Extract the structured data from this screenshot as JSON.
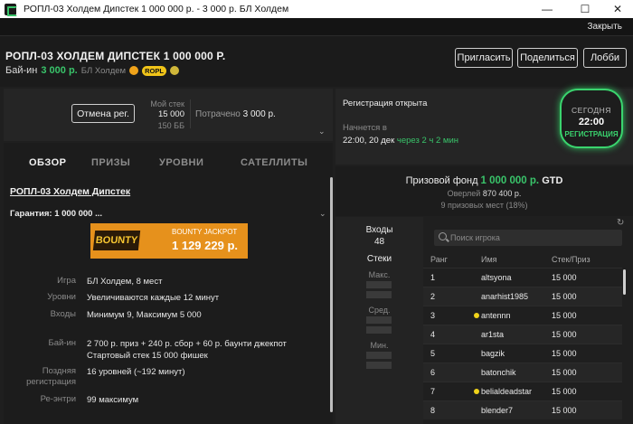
{
  "window": {
    "title": "РОПЛ-03 Холдем Дипстек 1 000 000 р. - 3 000 р. БЛ Холдем",
    "minimize": "—",
    "maximize": "☐",
    "close": "✕"
  },
  "menubar": {
    "close_label": "Закрыть"
  },
  "header": {
    "title": "РОПЛ-03 ХОЛДЕМ ДИПСТЕК 1 000 000 Р.",
    "buyin_label": "Бай-ин",
    "buyin_value": "3 000 р.",
    "game": "БЛ Холдем",
    "ropl_badge": "ROPL",
    "buttons": {
      "invite": "Пригласить",
      "share": "Поделиться",
      "lobby": "Лобби"
    }
  },
  "status": {
    "cancel_label": "Отмена рег.",
    "mystack_label": "Мой стек",
    "mystack_value": "15 000",
    "mystack_bb": "150 ББ",
    "spent_label": "Потрачено",
    "spent_value": "3 000 р."
  },
  "tabs": [
    {
      "label": "ОБЗОР",
      "active": true
    },
    {
      "label": "ПРИЗЫ",
      "active": false
    },
    {
      "label": "УРОВНИ",
      "active": false
    },
    {
      "label": "САТЕЛЛИТЫ",
      "active": false
    }
  ],
  "overview": {
    "title": "РОПЛ-03 Холдем Дипстек",
    "guarantee": "Гарантия: 1 000 000 ...",
    "jackpot": {
      "logo": "BOUNTY",
      "label": "BOUNTY JACKPOT",
      "value": "1 129 229 р."
    },
    "rows": [
      {
        "k": "Игра",
        "v": "БЛ Холдем, 8 мест"
      },
      {
        "k": "Уровни",
        "v": "Увеличиваются каждые 12 минут"
      },
      {
        "k": "Входы",
        "v": "Минимум 9, Максимум 5 000"
      },
      {
        "k": "Бай-ин",
        "v": "2 700 р. приз + 240 р. сбор + 60 р. баунти джекпот",
        "v2": "Стартовый стек 15 000 фишек"
      },
      {
        "k": "Поздняя",
        "k2": "регистрация",
        "v": "16 уровней (~192 минут)"
      },
      {
        "k": "Ре-энтри",
        "v": "99 максимум"
      }
    ]
  },
  "registration": {
    "status": "Регистрация открыта",
    "starts_label": "Начнется в",
    "starts_value": "22:00, 20 дек",
    "starts_in": "через 2 ч 2 мин",
    "today_label": "СЕГОДНЯ",
    "today_time": "22:00",
    "today_status": "РЕГИСТРАЦИЯ"
  },
  "prize": {
    "label": "Призовой фонд",
    "value": "1 000 000 р.",
    "gtd": "GTD",
    "overlay_label": "Оверлей",
    "overlay_value": "870 400 р.",
    "places": "9 призовых мест (18%)"
  },
  "entries": {
    "label": "Входы",
    "value": "48",
    "stacks_label": "Стеки",
    "max_label": "Макс.",
    "avg_label": "Сред.",
    "min_label": "Мин."
  },
  "players": {
    "search_placeholder": "Поиск игрока",
    "columns": {
      "rank": "Ранг",
      "name": "Имя",
      "stack": "Стек/Приз"
    },
    "rows": [
      {
        "rank": "1",
        "name": "altsyona",
        "stack": "15 000",
        "dot": false
      },
      {
        "rank": "2",
        "name": "anarhist1985",
        "stack": "15 000",
        "dot": false
      },
      {
        "rank": "3",
        "name": "antennn",
        "stack": "15 000",
        "dot": true
      },
      {
        "rank": "4",
        "name": "ar1sta",
        "stack": "15 000",
        "dot": false
      },
      {
        "rank": "5",
        "name": "bagzik",
        "stack": "15 000",
        "dot": false
      },
      {
        "rank": "6",
        "name": "batonchik",
        "stack": "15 000",
        "dot": false
      },
      {
        "rank": "7",
        "name": "belialdeadstar",
        "stack": "15 000",
        "dot": true
      },
      {
        "rank": "8",
        "name": "blender7",
        "stack": "15 000",
        "dot": false
      }
    ]
  },
  "colors": {
    "accent_green": "#39c46a",
    "jackpot_orange": "#e6911c",
    "online_dot": "#f0d31a"
  }
}
